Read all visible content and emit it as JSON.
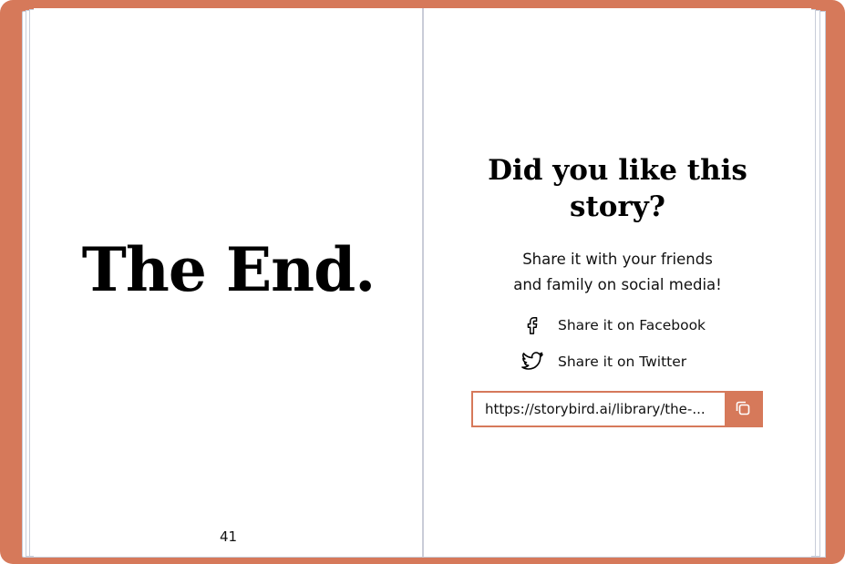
{
  "left_page": {
    "heading": "The End.",
    "page_number": "41"
  },
  "right_page": {
    "question": "Did you like this story?",
    "share_line_1": "Share it with your friends",
    "share_line_2": "and family on social media!",
    "facebook_label": "Share it on Facebook",
    "twitter_label": "Share it on Twitter",
    "url_value": "https://storybird.ai/library/the-...",
    "icons": {
      "facebook": "facebook-icon",
      "twitter": "twitter-icon",
      "copy": "copy-icon"
    }
  },
  "colors": {
    "cover": "#d6795a",
    "page": "#ffffff",
    "text": "#000000"
  }
}
